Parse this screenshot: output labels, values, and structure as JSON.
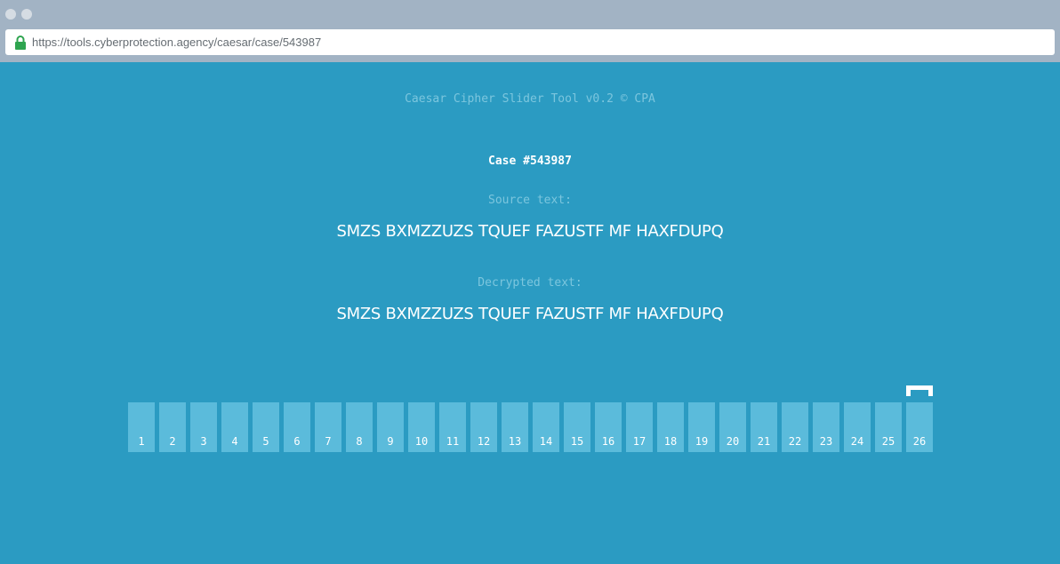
{
  "browser": {
    "url": "https://tools.cyberprotection.agency/caesar/case/543987"
  },
  "app": {
    "tool_title": "Caesar Cipher Slider Tool v0.2 © CPA",
    "case_title": "Case #543987",
    "source_label": "Source text:",
    "source_text": "SMZS BXMZZUZS TQUEF FAZUSTF MF HAXFDUPQ",
    "decrypted_label": "Decrypted text:",
    "decrypted_text": "SMZS BXMZZUZS TQUEF FAZUSTF MF HAXFDUPQ"
  },
  "slider": {
    "shifts": [
      "1",
      "2",
      "3",
      "4",
      "5",
      "6",
      "7",
      "8",
      "9",
      "10",
      "11",
      "12",
      "13",
      "14",
      "15",
      "16",
      "17",
      "18",
      "19",
      "20",
      "21",
      "22",
      "23",
      "24",
      "25",
      "26"
    ],
    "selected": "26"
  },
  "colors": {
    "background": "#2b9bc2",
    "tile": "#5bbbdb",
    "muted_text": "#7cc6de",
    "lock_green": "#2ea44f"
  }
}
